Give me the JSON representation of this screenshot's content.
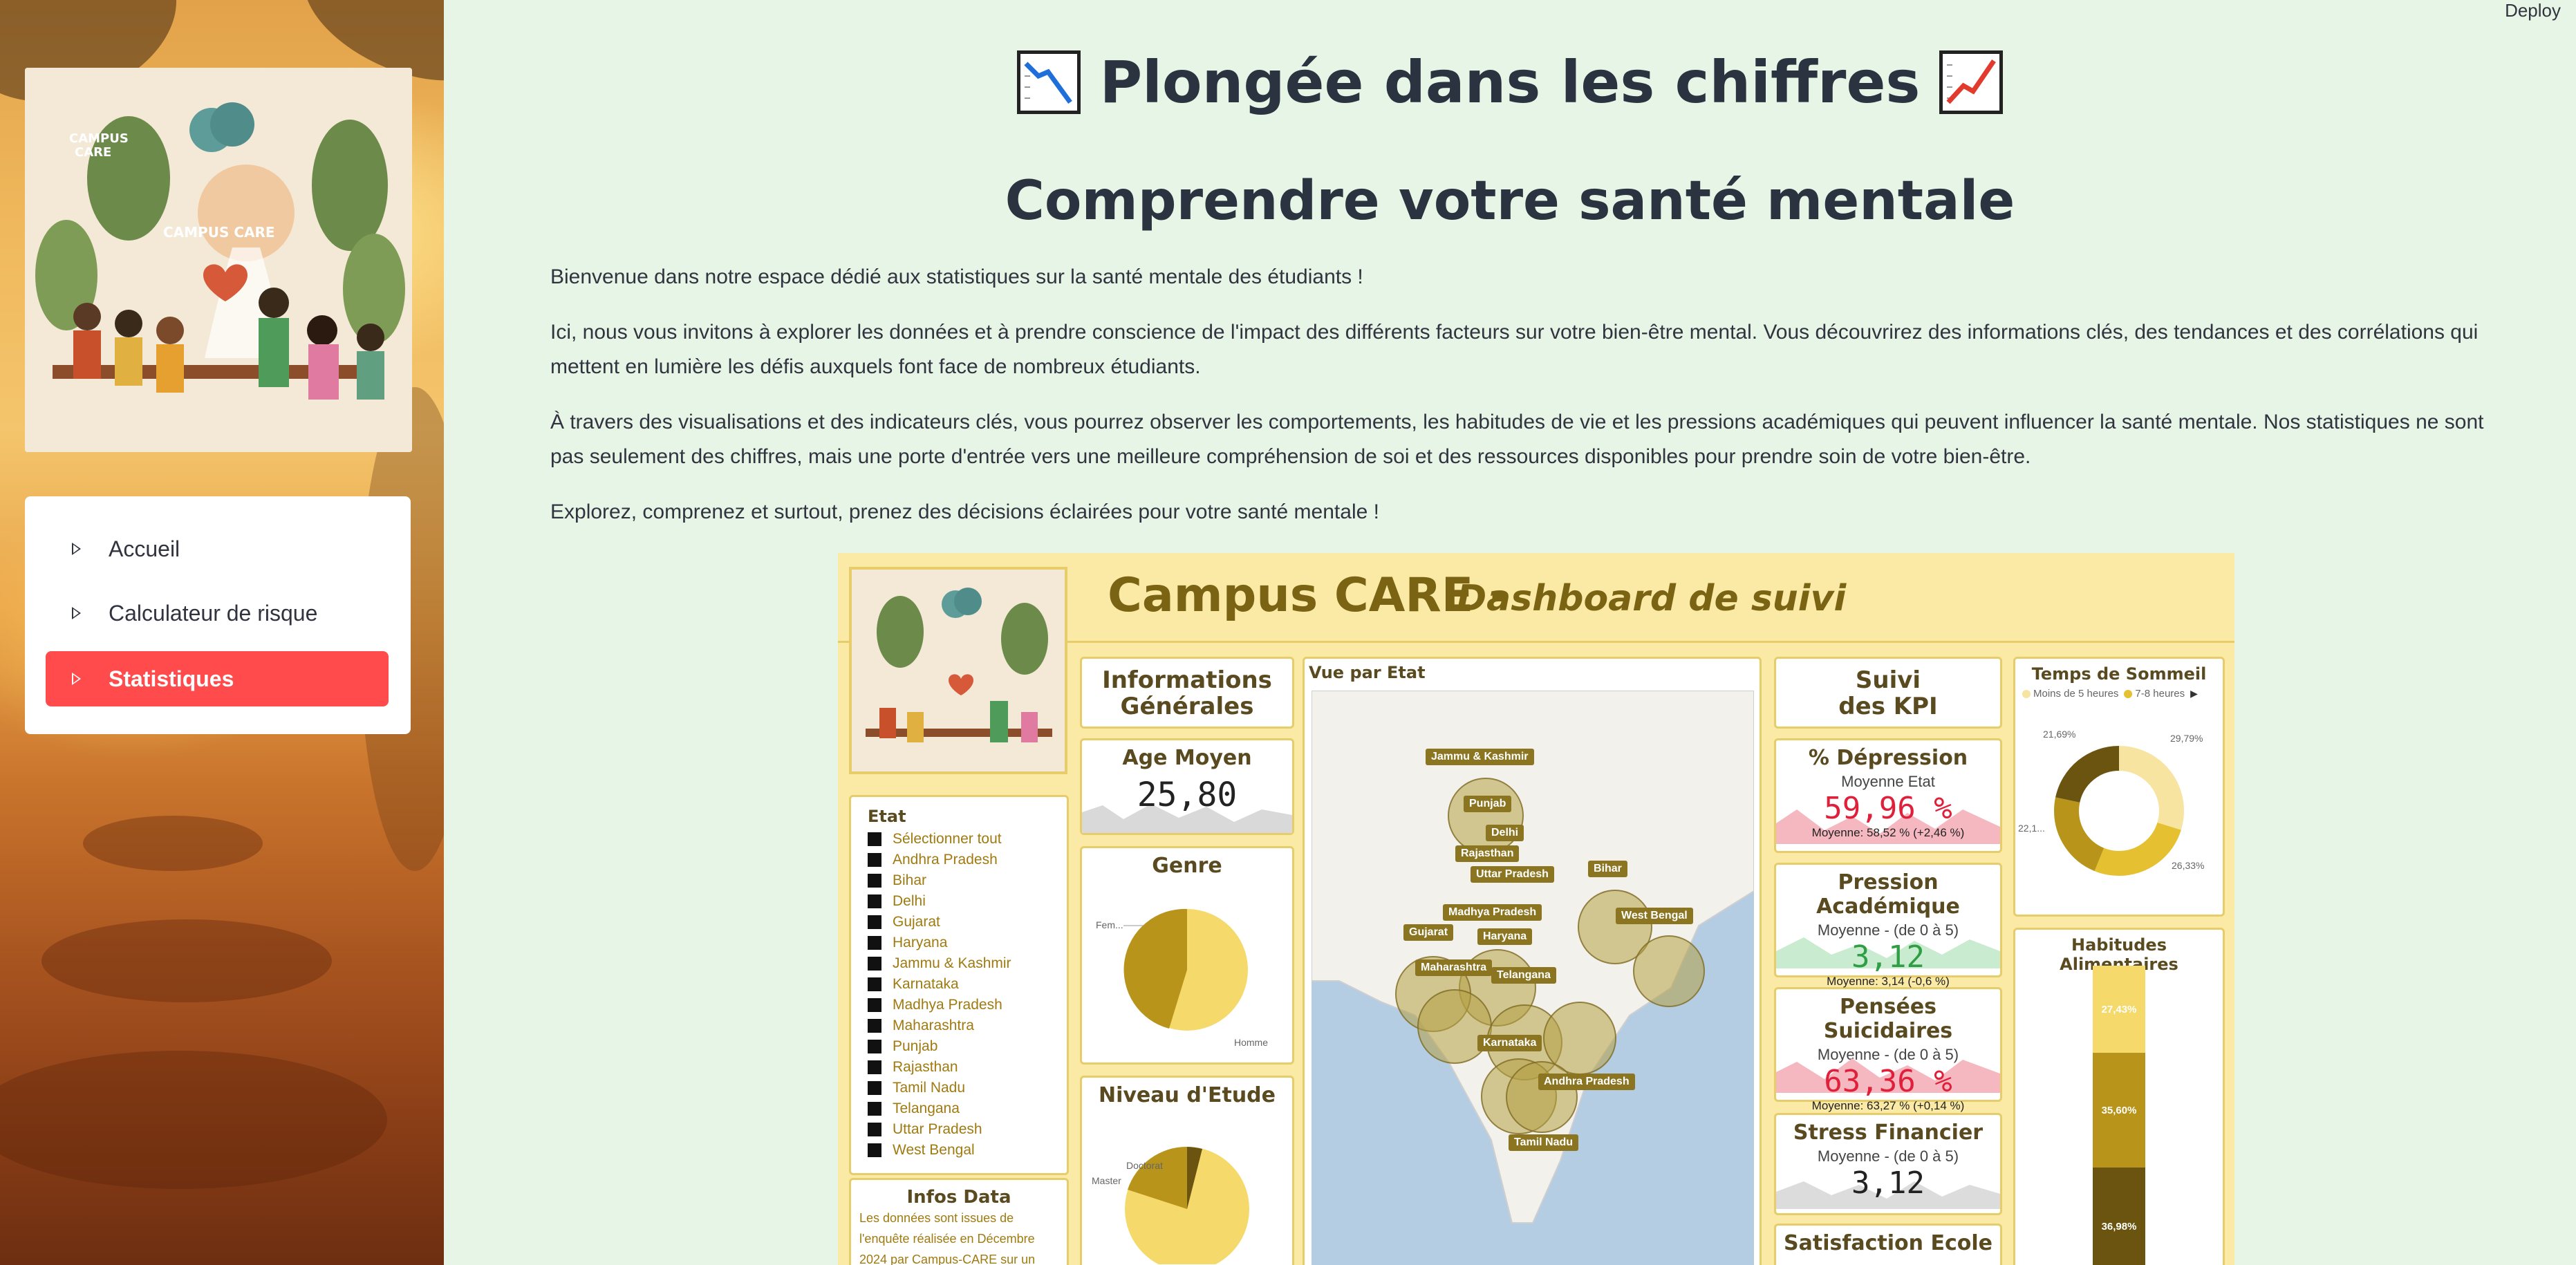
{
  "app": {
    "deploy_label": "Deploy"
  },
  "sidebar": {
    "logo_text": [
      "CAMPUS CARE",
      "CAMPUS",
      "CARE"
    ],
    "nav": [
      {
        "label": "Accueil",
        "active": false
      },
      {
        "label": "Calculateur de risque",
        "active": false
      },
      {
        "label": "Statistiques",
        "active": true
      }
    ],
    "accent_color": "#ff4b4b"
  },
  "main": {
    "title": "Plongée dans les chiffres",
    "title_icons": [
      "chart-decreasing-icon",
      "chart-increasing-icon"
    ],
    "subtitle": "Comprendre votre santé mentale",
    "paragraphs": [
      "Bienvenue dans notre espace dédié aux statistiques sur la santé mentale des étudiants !",
      "Ici, nous vous invitons à explorer les données et à prendre conscience de l'impact des différents facteurs sur votre bien-être mental. Vous découvrirez des informations clés, des tendances et des corrélations qui mettent en lumière les défis auxquels font face de nombreux étudiants.",
      "À travers des visualisations et des indicateurs clés, vous pourrez observer les comportements, les habitudes de vie et les pressions académiques qui peuvent influencer la santé mentale. Nos statistiques ne sont pas seulement des chiffres, mais une porte d'entrée vers une meilleure compréhension de soi et des ressources disponibles pour prendre soin de votre bien-être.",
      "Explorez, comprenez et surtout, prenez des décisions éclairées pour votre santé mentale !"
    ]
  },
  "dashboard": {
    "title_main": "Campus CARE -",
    "title_italic": "Dashboard de suivi",
    "info_title_line1": "Informations",
    "info_title_line2": "Générales",
    "age_title": "Age Moyen",
    "age_value": "25,80",
    "genre_title": "Genre",
    "genre_labels": [
      "Fem...",
      "Homme"
    ],
    "niveau_title": "Niveau d'Etude",
    "niveau_labels": [
      "Doctorat",
      "Master"
    ],
    "etat_title": "Etat",
    "etats": [
      "Sélectionner tout",
      "Andhra Pradesh",
      "Bihar",
      "Delhi",
      "Gujarat",
      "Haryana",
      "Jammu & Kashmir",
      "Karnataka",
      "Madhya Pradesh",
      "Maharashtra",
      "Punjab",
      "Rajasthan",
      "Tamil Nadu",
      "Telangana",
      "Uttar Pradesh",
      "West Bengal"
    ],
    "infos_title": "Infos Data",
    "infos_lines": [
      "Les données sont issues de",
      "l'enquête réalisée en Décembre",
      "2024 par Campus-CARE sur un"
    ],
    "map_title": "Vue par Etat",
    "map_labels": [
      "Jammu & Kashmir",
      "Punjab",
      "Delhi",
      "Rajasthan",
      "Uttar Pradesh",
      "Bihar",
      "West Bengal",
      "Madhya Pradesh",
      "Gujarat",
      "Haryana",
      "Maharashtra",
      "Telangana",
      "Karnataka",
      "Andhra Pradesh",
      "Tamil Nadu"
    ],
    "kpi_title_line1": "Suivi",
    "kpi_title_line2": "des KPI",
    "kpis": [
      {
        "title": "% Dépression",
        "sub": "Moyenne Etat",
        "value": "59,96 %",
        "foot": "Moyenne: 58,52 % (+2,46 %)",
        "color": "#e0203a"
      },
      {
        "title": "Pression Académique",
        "sub": "Moyenne - (de 0 à 5)",
        "value": "3,12",
        "foot": "Moyenne: 3,14 (-0,6 %)",
        "color": "#2f9e44"
      },
      {
        "title": "Pensées Suicidaires",
        "sub": "Moyenne - (de 0 à 5)",
        "value": "63,36 %",
        "foot": "Moyenne: 63,27 % (+0,14 %)",
        "color": "#e0203a"
      },
      {
        "title": "Stress Financier",
        "sub": "Moyenne - (de 0 à 5)",
        "value": "3,12",
        "foot": "",
        "color": "#222222"
      },
      {
        "title": "Satisfaction Ecole",
        "sub": "",
        "value": "",
        "foot": "",
        "color": "#222222"
      }
    ],
    "sommeil_title": "Temps de Sommeil",
    "sommeil_legend": [
      "Moins de 5 heures",
      "7-8 heures"
    ],
    "sommeil_pcts": [
      "21,69%",
      "29,79%",
      "22,1...",
      "26,33%"
    ],
    "habitudes_title": "Habitudes Alimentaires",
    "habitudes_pcts": [
      "27,43%",
      "35,60%",
      "36,98%"
    ]
  }
}
